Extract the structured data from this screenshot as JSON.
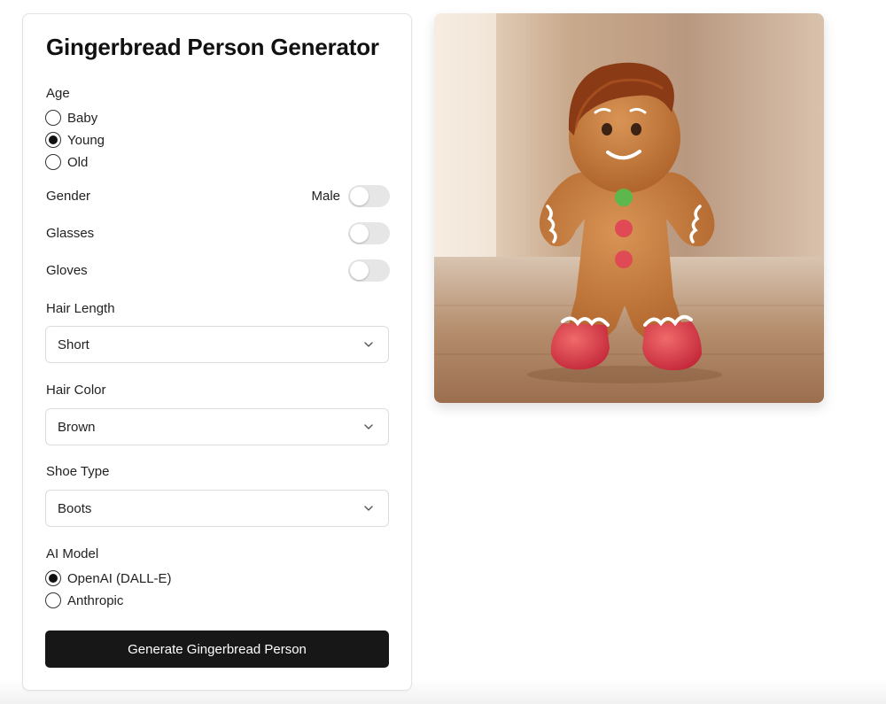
{
  "app": {
    "title": "Gingerbread Person Generator"
  },
  "age": {
    "label": "Age",
    "options": [
      {
        "label": "Baby",
        "selected": false
      },
      {
        "label": "Young",
        "selected": true
      },
      {
        "label": "Old",
        "selected": false
      }
    ]
  },
  "gender": {
    "label": "Gender",
    "value_text": "Male",
    "enabled": false
  },
  "glasses": {
    "label": "Glasses",
    "enabled": false
  },
  "gloves": {
    "label": "Gloves",
    "enabled": false
  },
  "hair_length": {
    "label": "Hair Length",
    "value": "Short"
  },
  "hair_color": {
    "label": "Hair Color",
    "value": "Brown"
  },
  "shoe_type": {
    "label": "Shoe Type",
    "value": "Boots"
  },
  "ai_model": {
    "label": "AI Model",
    "options": [
      {
        "label": "OpenAI (DALL-E)",
        "selected": true
      },
      {
        "label": "Anthropic",
        "selected": false
      }
    ]
  },
  "generate_button": {
    "label": "Generate Gingerbread Person"
  },
  "icons": {
    "dropdown": "chevron-down-icon"
  },
  "colors": {
    "button_bg": "#171717",
    "toggle_off": "#e6e6e6",
    "cookie": "#c27a3c",
    "icing": "#ffffff",
    "hair": "#8a3a14",
    "boots": "#e0454a",
    "button_green": "#5cb84c",
    "button_red": "#e04a55"
  }
}
